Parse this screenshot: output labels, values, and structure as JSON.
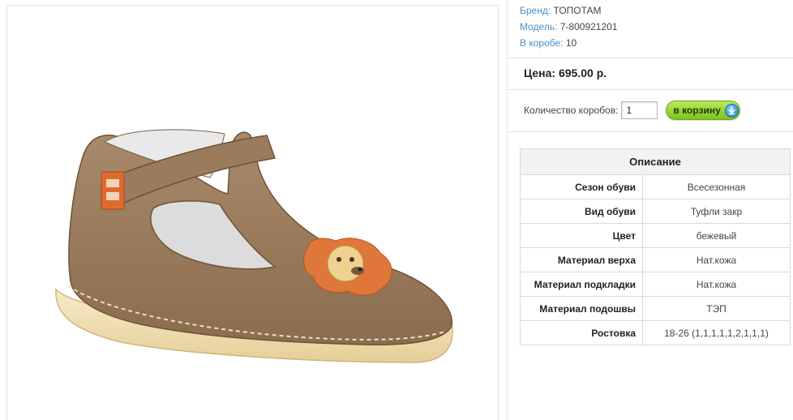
{
  "product": {
    "brand_label": "Бренд:",
    "brand_value": "ТОПОТАМ",
    "model_label": "Модель:",
    "model_value": "7-800921201",
    "box_label": "В коробе:",
    "box_value": "10"
  },
  "price": {
    "text": "Цена: 695.00 р."
  },
  "order": {
    "qty_label": "Количество коробов:",
    "qty_value": "1",
    "cart_label": "в корзину",
    "cart_icon": "arrow-down-circle-icon"
  },
  "description": {
    "title": "Описание",
    "rows": [
      {
        "key": "Сезон обуви",
        "value": "Всесезонная"
      },
      {
        "key": "Вид обуви",
        "value": "Туфли закр"
      },
      {
        "key": "Цвет",
        "value": "бежевый"
      },
      {
        "key": "Материал верха",
        "value": "Нат.кожа"
      },
      {
        "key": "Материал подкладки",
        "value": "Нат.кожа"
      },
      {
        "key": "Материал подошвы",
        "value": "ТЭП"
      },
      {
        "key": "Ростовка",
        "value": "18-26 (1,1,1,1,1,2,1,1,1)"
      }
    ]
  },
  "colors": {
    "link_blue": "#4a8fc7",
    "button_green": "#7fc21e",
    "shoe_leather": "#9c7d5e",
    "sole": "#f3e3b4",
    "lion_orange": "#e0773a"
  }
}
